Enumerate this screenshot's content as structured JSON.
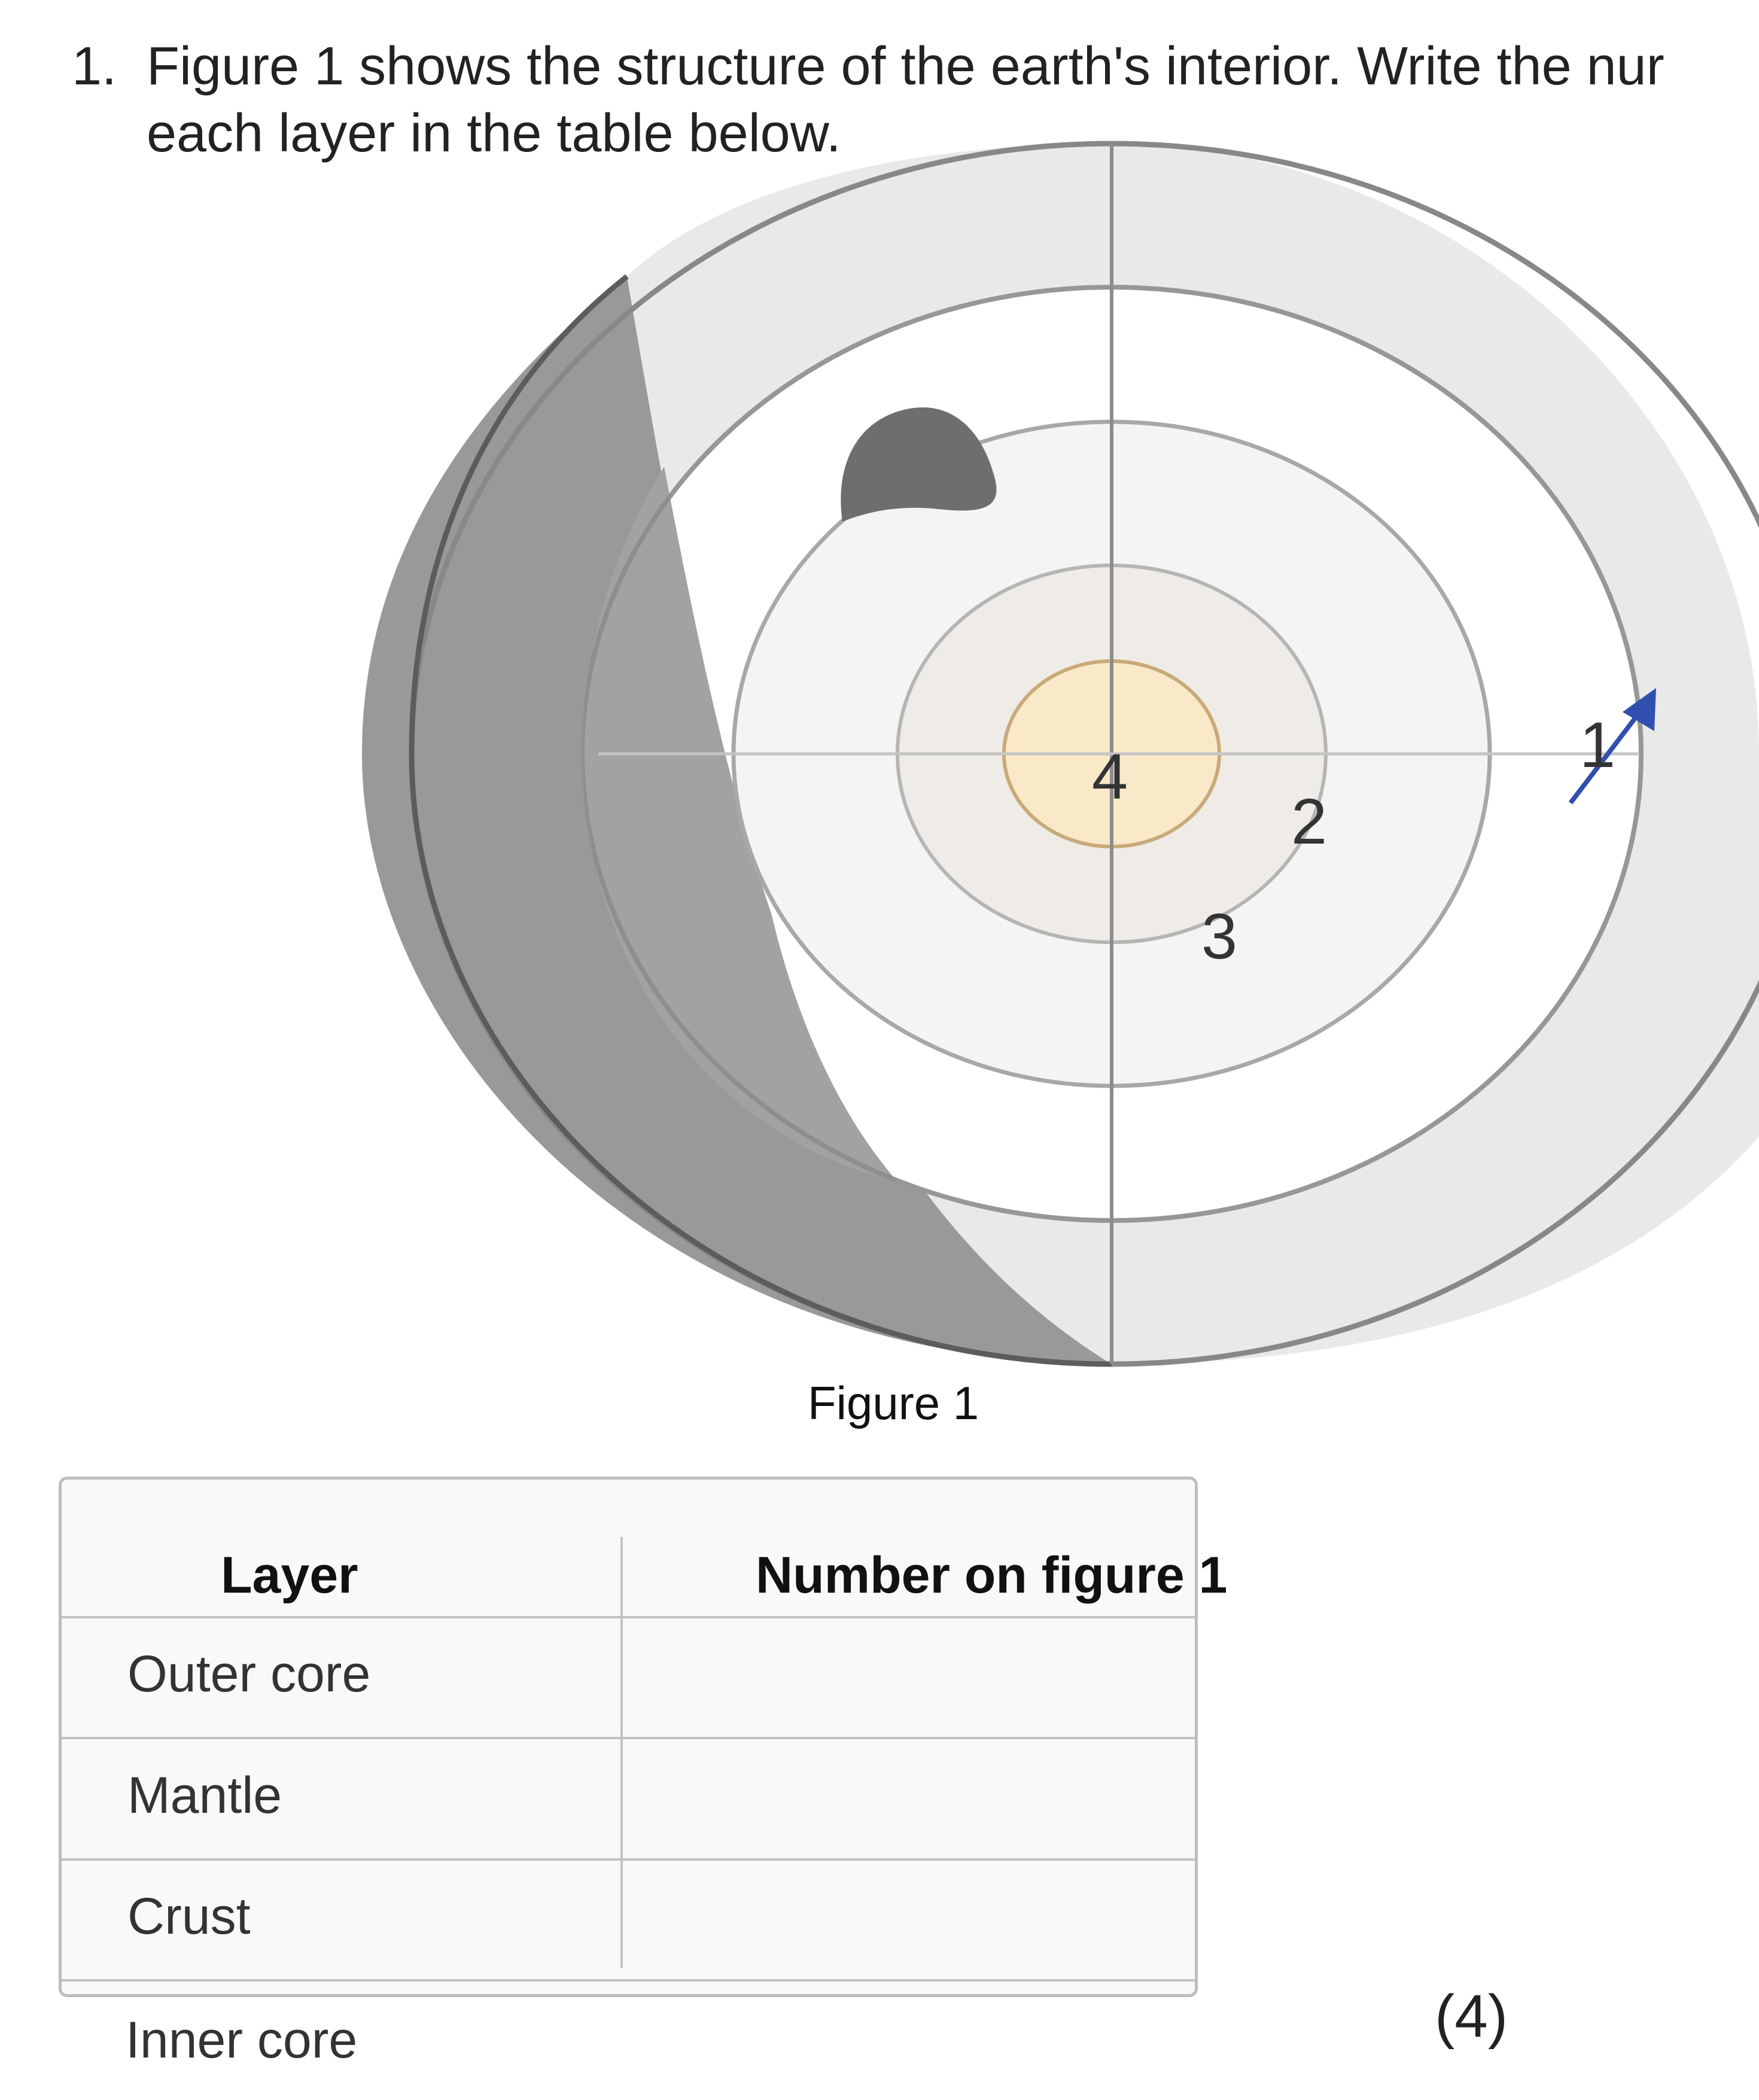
{
  "question": {
    "number": "1.",
    "line1": "Figure 1 shows the structure of the earth's interior. Write the nur",
    "line2": "each layer in the table below."
  },
  "figure": {
    "caption": "Figure 1",
    "labels": [
      "1",
      "2",
      "3",
      "4"
    ],
    "arrow_color": "#3050b0",
    "inner_core_color": "#f9e9c9"
  },
  "table": {
    "headers": [
      "Layer",
      "Number on figure 1"
    ],
    "rows": [
      "Outer core",
      "Mantle",
      "Crust"
    ],
    "extra_row": "Inner core"
  },
  "marks": "(4)"
}
